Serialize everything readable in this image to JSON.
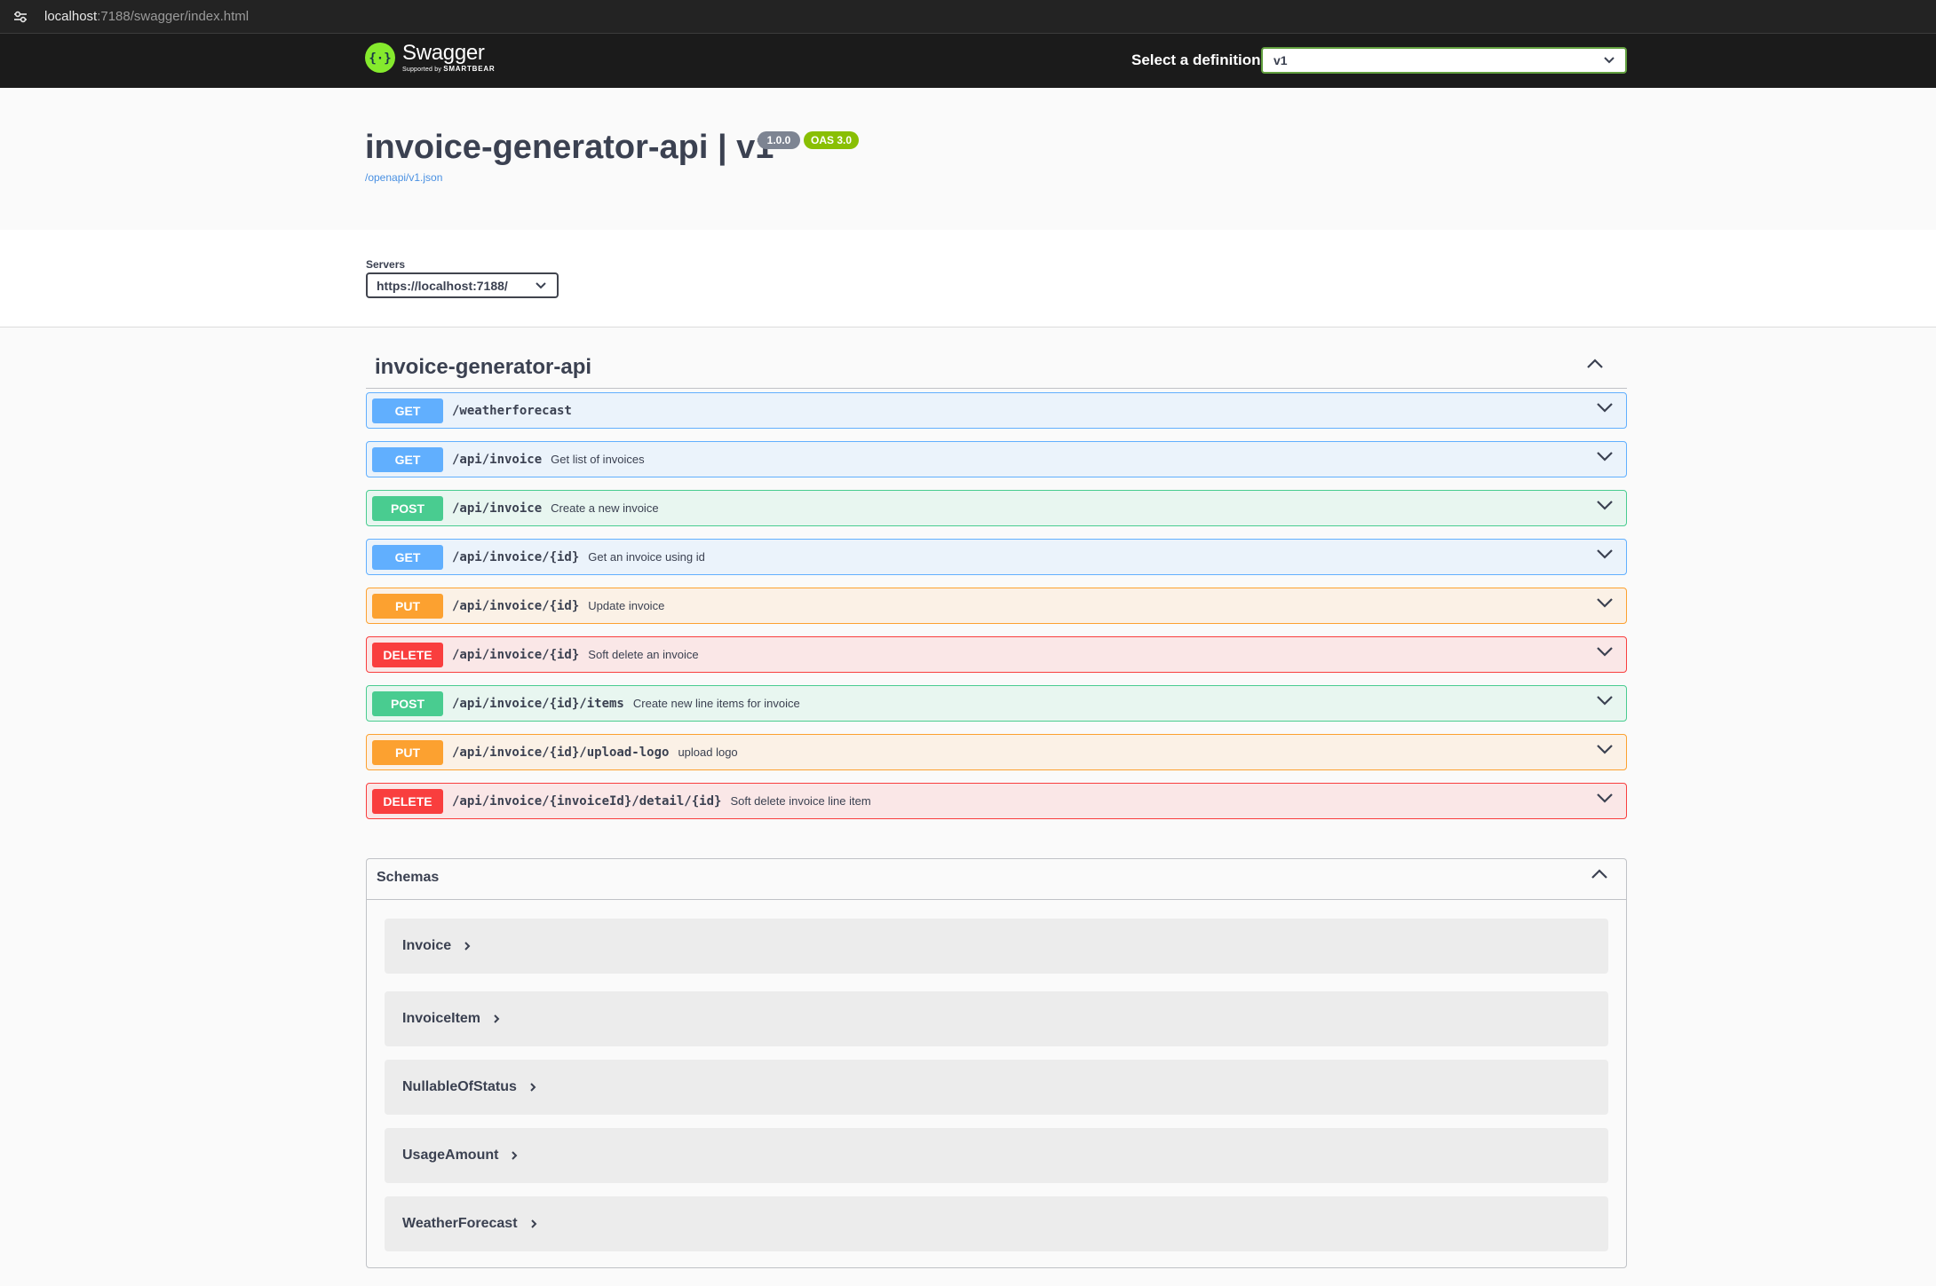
{
  "browser": {
    "url_host": "localhost",
    "url_rest": ":7188/swagger/index.html"
  },
  "topbar": {
    "logo_title": "Swagger",
    "logo_sub_prefix": "Supported by",
    "logo_sub_brand": "SMARTBEAR",
    "definition_label": "Select a definition",
    "definition_value": "v1"
  },
  "info": {
    "title": "invoice-generator-api | v1",
    "version_badge": "1.0.0",
    "oas_badge": "OAS 3.0",
    "spec_link": "/openapi/v1.json"
  },
  "servers": {
    "label": "Servers",
    "selected": "https://localhost:7188/"
  },
  "tag": {
    "name": "invoice-generator-api"
  },
  "operations": [
    {
      "method": "GET",
      "path": "/weatherforecast",
      "summary": ""
    },
    {
      "method": "GET",
      "path": "/api/invoice",
      "summary": "Get list of invoices"
    },
    {
      "method": "POST",
      "path": "/api/invoice",
      "summary": "Create a new invoice"
    },
    {
      "method": "GET",
      "path": "/api/invoice/{id}",
      "summary": "Get an invoice using id"
    },
    {
      "method": "PUT",
      "path": "/api/invoice/{id}",
      "summary": "Update invoice"
    },
    {
      "method": "DELETE",
      "path": "/api/invoice/{id}",
      "summary": "Soft delete an invoice"
    },
    {
      "method": "POST",
      "path": "/api/invoice/{id}/items",
      "summary": "Create new line items for invoice"
    },
    {
      "method": "PUT",
      "path": "/api/invoice/{id}/upload-logo",
      "summary": "upload logo"
    },
    {
      "method": "DELETE",
      "path": "/api/invoice/{invoiceId}/detail/{id}",
      "summary": "Soft delete invoice line item"
    }
  ],
  "schemas": {
    "title": "Schemas",
    "models": [
      "Invoice",
      "InvoiceItem",
      "NullableOfStatus",
      "UsageAmount",
      "WeatherForecast"
    ]
  },
  "colors": {
    "get": "#61affe",
    "post": "#49cc90",
    "put": "#fca130",
    "delete": "#f93e3e",
    "swagger_green": "#85ea2d",
    "topbar": "#1b1b1b"
  },
  "icons": {
    "address_bar": "site-settings-icon",
    "logo": "swagger-logo-icon",
    "dropdown": "chevron-down-icon",
    "collapse": "chevron-up-icon",
    "expand_model": "chevron-right-icon"
  }
}
